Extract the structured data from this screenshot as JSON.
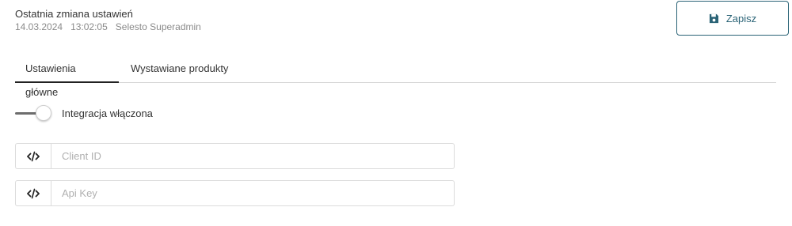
{
  "last_change": {
    "title": "Ostatnia zmiana ustawień",
    "date": "14.03.2024",
    "time": "13:02:05",
    "user": "Selesto Superadmin"
  },
  "save_button": {
    "label": "Zapisz",
    "icon": "save-icon"
  },
  "tabs": [
    {
      "label": "Ustawienia główne",
      "active": true
    },
    {
      "label": "Wystawiane produkty",
      "active": false
    }
  ],
  "integration_toggle": {
    "label": "Integracja włączona",
    "enabled": true
  },
  "fields": {
    "client_id": {
      "placeholder": "Client ID",
      "value": "",
      "icon": "code-icon"
    },
    "api_key": {
      "placeholder": "Api Key",
      "value": "",
      "icon": "code-icon"
    }
  },
  "colors": {
    "accent": "#2a6376",
    "border": "#dcdcdc",
    "toggle_track": "#6d6d6d"
  }
}
